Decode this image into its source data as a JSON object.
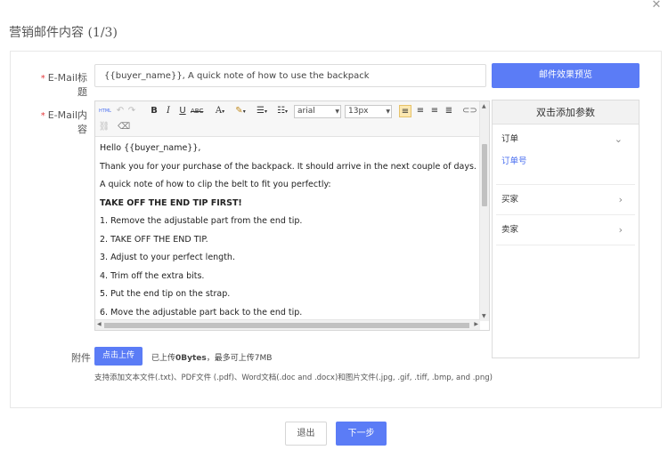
{
  "dialog": {
    "title": "营销邮件内容 (1/3)",
    "close_icon": "close-icon"
  },
  "subject": {
    "required_mark": "*",
    "label": "E-Mail标题",
    "value": "{{buyer_name}}, A quick note of how to use the backpack",
    "preview_button": "邮件效果预览"
  },
  "body": {
    "required_mark": "*",
    "label": "E-Mail内容",
    "toolbar": {
      "html_label": "HTML",
      "font_color_label": "A",
      "font_family": "arial",
      "font_size": "13px"
    },
    "lines": [
      "Hello {{buyer_name}},",
      "Thank you for your purchase of the backpack. It should arrive in the next couple of days.",
      "A quick note of how to clip the belt to fit you perfectly:",
      "TAKE OFF THE END TIP FIRST!",
      "1. Remove the adjustable part from the end tip.",
      "2. TAKE OFF THE END TIP.",
      "3. Adjust to your perfect length.",
      "4. Trim off the extra bits.",
      "5. Put the end tip on the strap.",
      "6. Move the adjustable part back to the end tip."
    ]
  },
  "params": {
    "title": "双击添加参数",
    "groups": [
      {
        "label": "订单",
        "expanded": true,
        "items": [
          "订单号"
        ]
      },
      {
        "label": "买家",
        "expanded": false
      },
      {
        "label": "卖家",
        "expanded": false
      }
    ]
  },
  "attachment": {
    "label": "附件",
    "upload_button": "点击上传",
    "note_prefix": "已上传",
    "uploaded_size": "0Bytes",
    "note_suffix": "，最多可上传7MB",
    "file_types": "支持添加文本文件(.txt)、PDF文件 (.pdf)、Word文档(.doc and .docx)和图片文件(.jpg, .gif, .tiff, .bmp, and .png)"
  },
  "footer": {
    "exit_button": "退出",
    "next_button": "下一步"
  },
  "colors": {
    "accent": "#5b7cf6",
    "required": "#e4393c",
    "link": "#4a6ff0"
  }
}
